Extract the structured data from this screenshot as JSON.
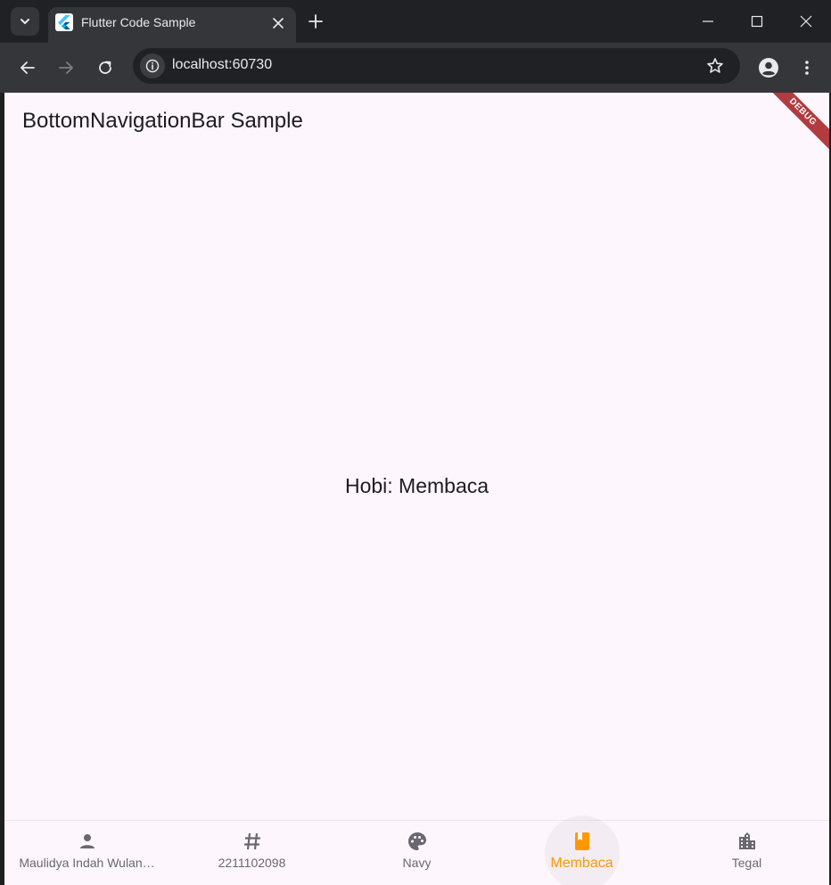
{
  "browser": {
    "tab_title": "Flutter Code Sample",
    "url": "localhost:60730"
  },
  "app": {
    "title": "BottomNavigationBar Sample",
    "debug_banner": "DEBUG",
    "body_text": "Hobi: Membaca",
    "accent_color": "#ff9800",
    "background_color": "#fdf6fd"
  },
  "bottom_nav": {
    "active_index": 3,
    "items": [
      {
        "label": "Maulidya Indah Wulan…",
        "icon": "person-icon"
      },
      {
        "label": "2211102098",
        "icon": "tag-icon"
      },
      {
        "label": "Navy",
        "icon": "palette-icon"
      },
      {
        "label": "Membaca",
        "icon": "book-icon"
      },
      {
        "label": "Tegal",
        "icon": "location-city-icon"
      }
    ]
  }
}
